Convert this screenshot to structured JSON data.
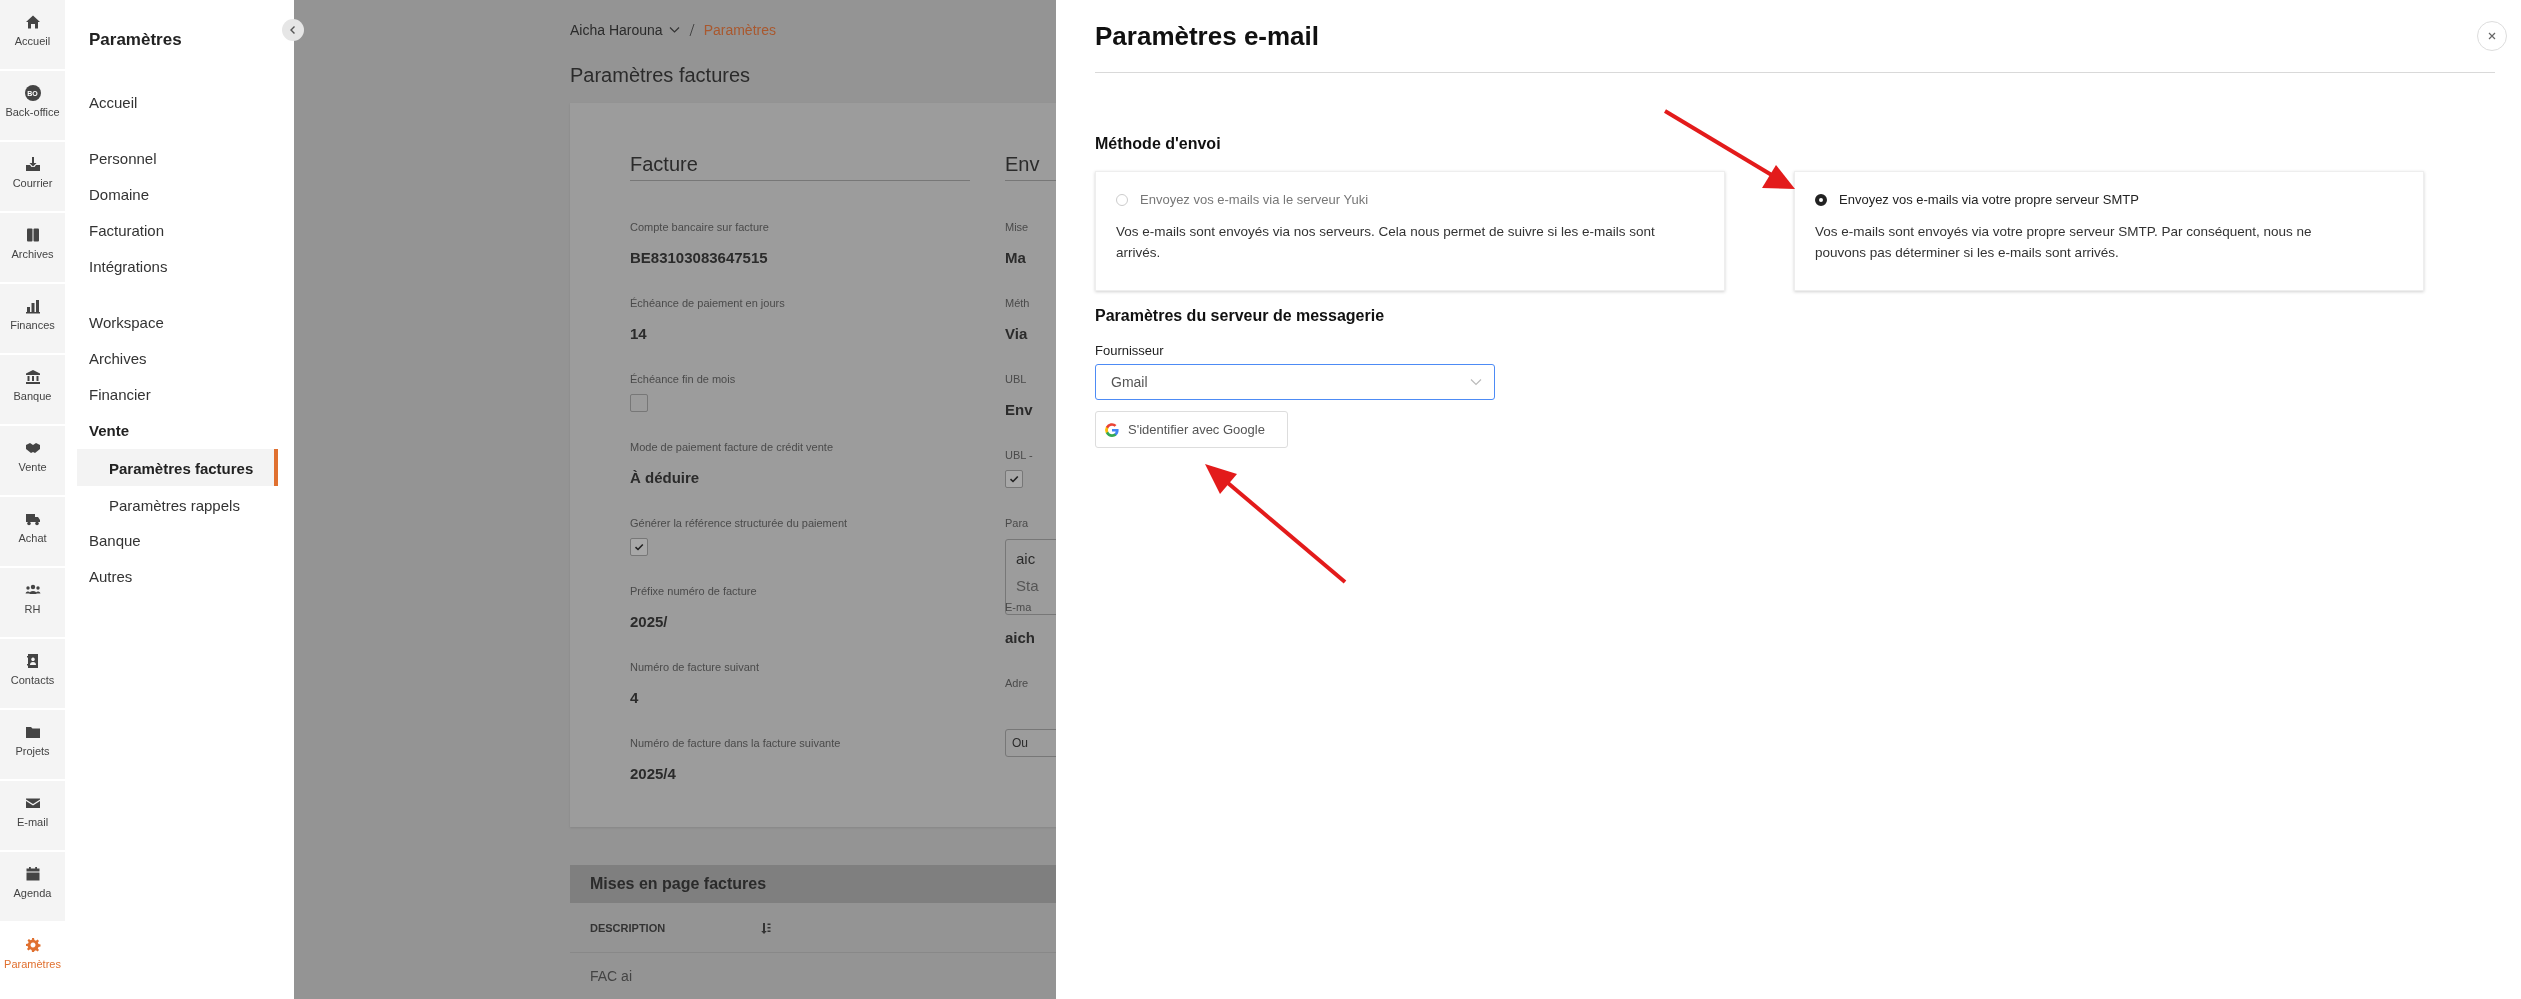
{
  "rail": {
    "items": [
      {
        "label": "Accueil",
        "selected": false
      },
      {
        "label": "Back-office",
        "badge": "BO",
        "selected": false
      },
      {
        "label": "Courrier",
        "selected": false
      },
      {
        "label": "Archives",
        "selected": false
      },
      {
        "label": "Finances",
        "selected": false
      },
      {
        "label": "Banque",
        "selected": false
      },
      {
        "label": "Vente",
        "selected": false
      },
      {
        "label": "Achat",
        "selected": false
      },
      {
        "label": "RH",
        "selected": false
      },
      {
        "label": "Contacts",
        "selected": false
      },
      {
        "label": "Projets",
        "selected": false
      },
      {
        "label": "E-mail",
        "selected": false
      },
      {
        "label": "Agenda",
        "selected": false
      },
      {
        "label": "Paramètres",
        "selected": true
      }
    ]
  },
  "sidebar": {
    "title": "Paramètres",
    "groups": [
      {
        "items": [
          {
            "label": "Accueil",
            "selected": false,
            "expanded": false
          }
        ]
      },
      {
        "items": [
          {
            "label": "Personnel",
            "selected": false,
            "expanded": false
          },
          {
            "label": "Domaine",
            "selected": false,
            "expanded": false
          },
          {
            "label": "Facturation",
            "selected": false,
            "expanded": false
          },
          {
            "label": "Intégrations",
            "selected": false,
            "expanded": false
          }
        ]
      },
      {
        "items": [
          {
            "label": "Workspace",
            "selected": false,
            "expanded": false
          },
          {
            "label": "Archives",
            "selected": false,
            "expanded": false
          },
          {
            "label": "Financier",
            "selected": false,
            "expanded": false
          },
          {
            "label": "Vente",
            "selected": false,
            "expanded": true,
            "children": [
              {
                "label": "Paramètres factures",
                "selected": true
              },
              {
                "label": "Paramètres rappels",
                "selected": false
              }
            ]
          },
          {
            "label": "Banque",
            "selected": false,
            "expanded": false
          },
          {
            "label": "Autres",
            "selected": false,
            "expanded": false
          }
        ]
      }
    ]
  },
  "main": {
    "breadcrumb": {
      "account": "Aicha Harouna",
      "current": "Paramètres"
    },
    "title": "Paramètres factures",
    "columns": [
      {
        "heading": "Facture",
        "fields": [
          {
            "kind": "text",
            "label": "Compte bancaire sur facture",
            "value": "BE83103083647515"
          },
          {
            "kind": "text",
            "label": "Échéance de paiement en jours",
            "value": "14"
          },
          {
            "kind": "checkbox",
            "label": "Échéance fin de mois",
            "checked": false
          },
          {
            "kind": "text",
            "label": "Mode de paiement facture de crédit vente",
            "value": "À déduire"
          },
          {
            "kind": "checkbox",
            "label": "Générer la référence structurée du paiement",
            "checked": true
          },
          {
            "kind": "text",
            "label": "Préfixe numéro de facture",
            "value": "2025/"
          },
          {
            "kind": "text",
            "label": "Numéro de facture suivant",
            "value": "4"
          },
          {
            "kind": "text",
            "label": "Numéro de facture dans la facture suivante",
            "value": "2025/4"
          }
        ]
      },
      {
        "heading": "Env",
        "fields": [
          {
            "kind": "text",
            "label": "Mise",
            "value": "Ma"
          },
          {
            "kind": "text",
            "label": "Méth",
            "value": "Via"
          },
          {
            "kind": "text",
            "label": "UBL",
            "value": "Env"
          },
          {
            "kind": "checkbox",
            "label": "UBL -",
            "checked": true
          },
          {
            "kind": "box",
            "label": "Para",
            "lines": [
              "aic",
              "Sta"
            ]
          },
          {
            "kind": "text",
            "label": "E-ma",
            "value": "aich"
          },
          {
            "kind": "button",
            "label": "Adre",
            "value": "Ou"
          }
        ]
      }
    ],
    "table": {
      "title": "Mises en page factures",
      "columns": [
        "DESCRIPTION"
      ],
      "rows": [
        [
          "FAC ai"
        ]
      ]
    }
  },
  "drawer": {
    "title": "Paramètres e-mail",
    "method": {
      "title": "Méthode d'envoi",
      "options": [
        {
          "title": "Envoyez vos e-mails via le serveur Yuki",
          "description": "Vos e-mails sont envoyés via nos serveurs. Cela nous permet de suivre si les e-mails sont arrivés.",
          "selected": false
        },
        {
          "title": "Envoyez vos e-mails via votre propre serveur SMTP",
          "description": "Vos e-mails sont envoyés via votre propre serveur SMTP. Par conséquent, nous ne pouvons pas déterminer si les e-mails sont arrivés.",
          "selected": true
        }
      ]
    },
    "server": {
      "title": "Paramètres du serveur de messagerie",
      "provider": {
        "label": "Fournisseur",
        "value": "Gmail"
      },
      "google_button": "S'identifier avec Google"
    }
  }
}
